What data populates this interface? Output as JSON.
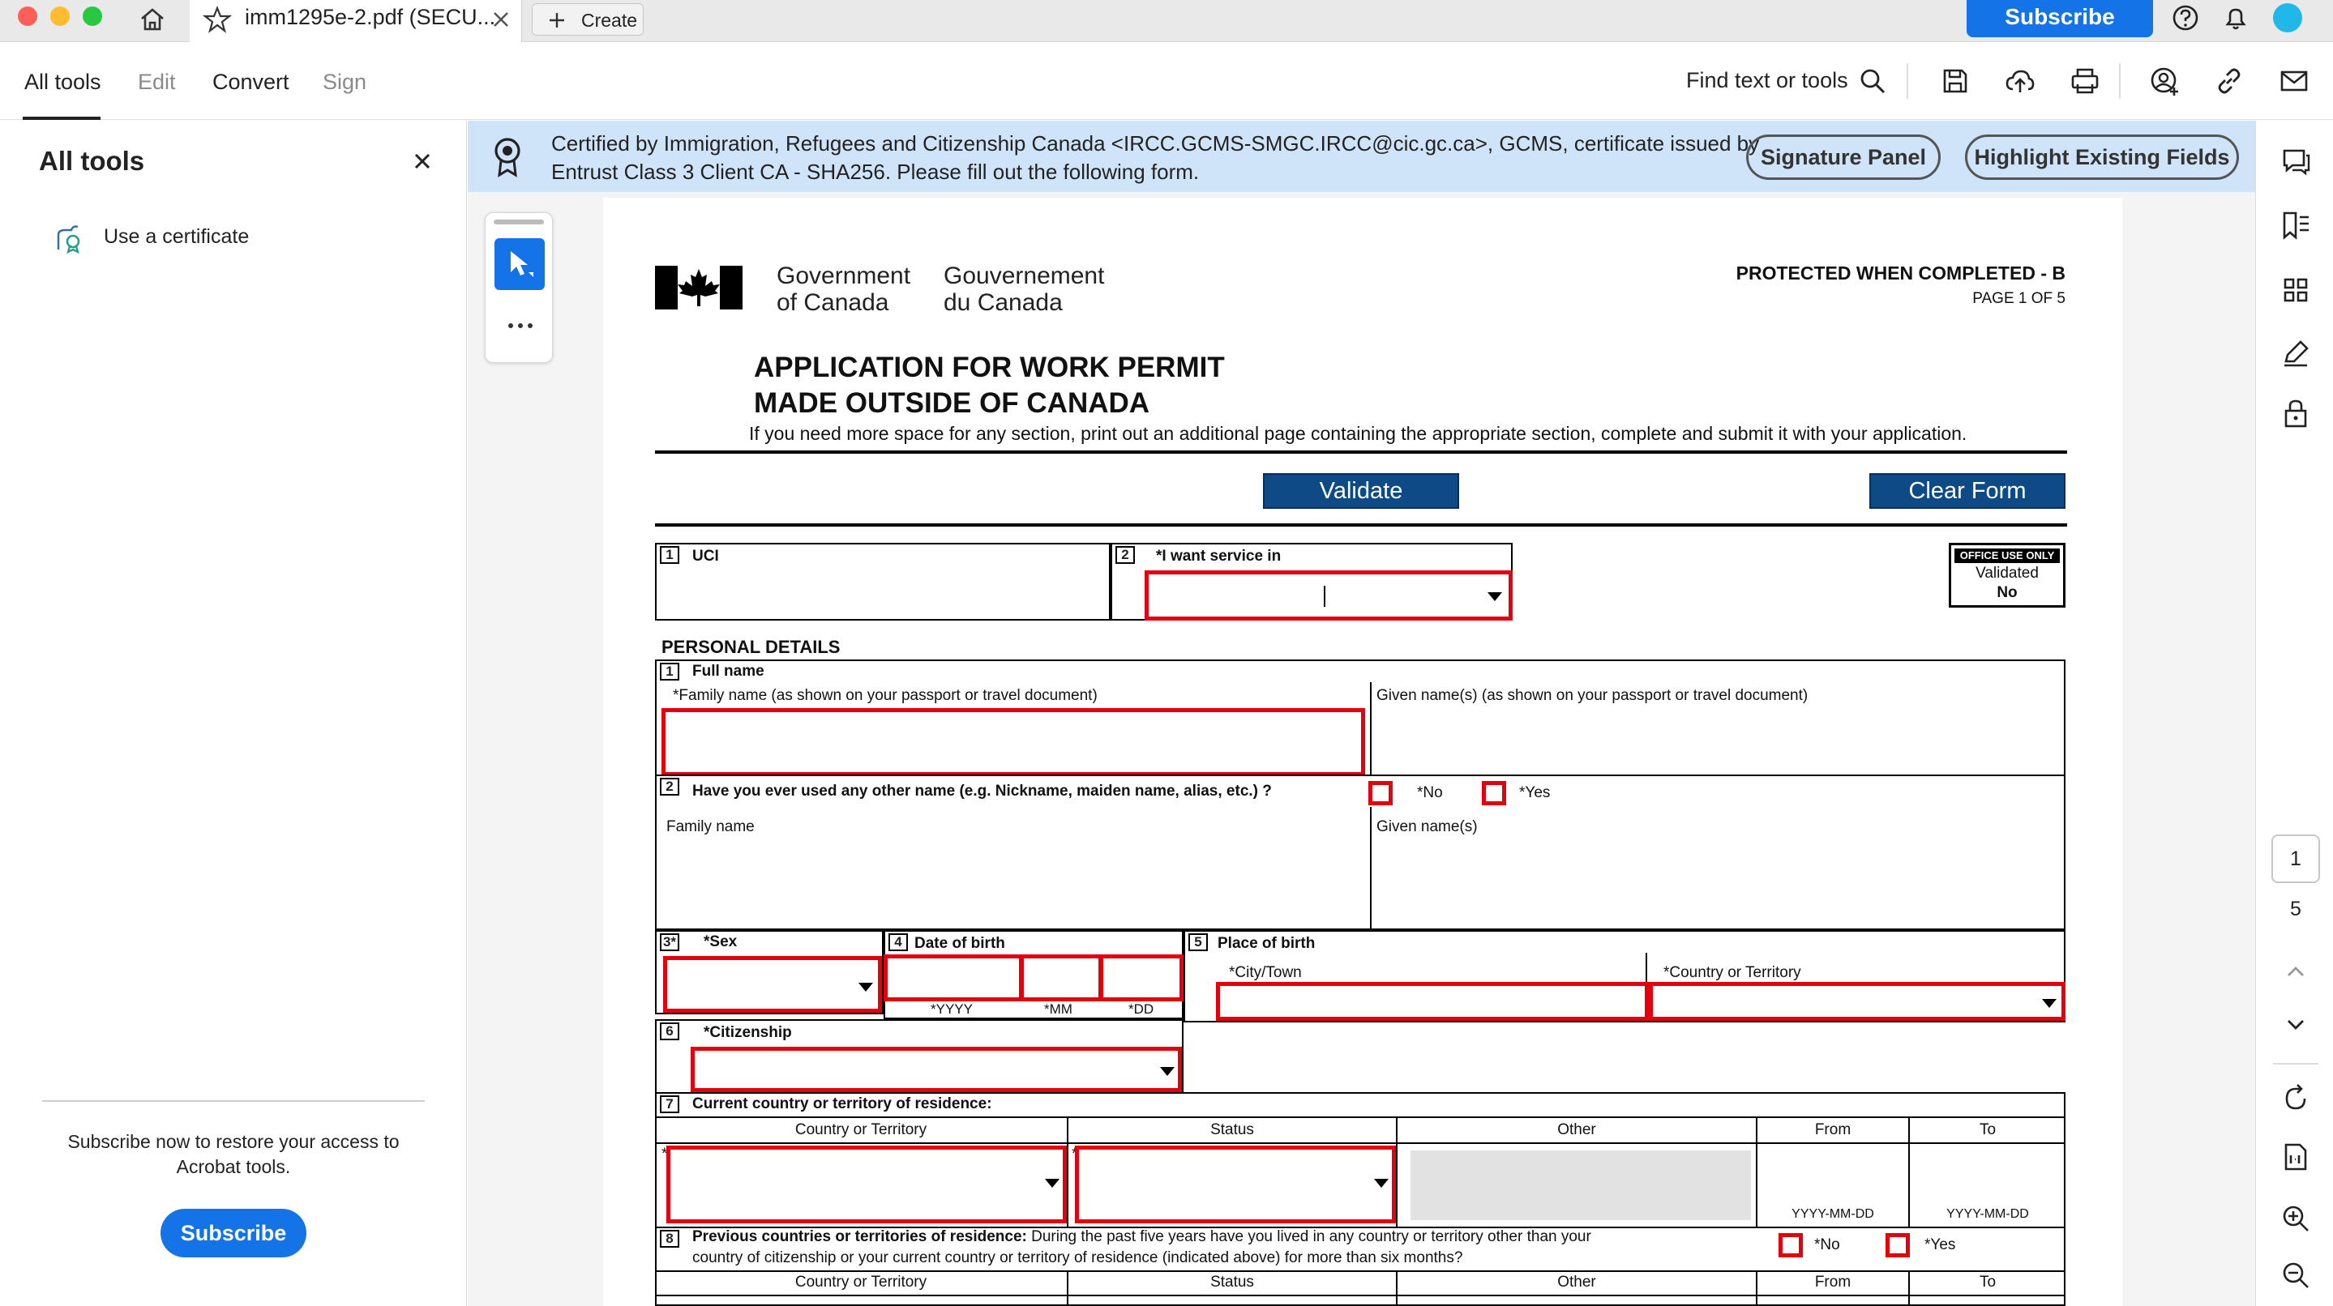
{
  "titlebar": {
    "tab_title": "imm1295e-2.pdf (SECU...",
    "create_label": "Create",
    "subscribe_label": "Subscribe"
  },
  "toolbar": {
    "menus": [
      "All tools",
      "Edit",
      "Convert",
      "Sign"
    ],
    "find_label": "Find text or tools"
  },
  "left_panel": {
    "title": "All tools",
    "tool_item": "Use a certificate",
    "restore_text": "Subscribe now to restore your access to Acrobat tools.",
    "subscribe_label": "Subscribe"
  },
  "banner": {
    "line1": "Certified by Immigration, Refugees and Citizenship Canada <IRCC.GCMS-SMGC.IRCC@cic.gc.ca>, GCMS, certificate issued by",
    "line2": "Entrust Class 3 Client CA - SHA256.  Please fill out the following form.",
    "signature_panel": "Signature Panel",
    "highlight_fields": "Highlight Existing Fields"
  },
  "right_rail": {
    "current_page": "1",
    "total_pages": "5"
  },
  "form": {
    "gov_en_1": "Government",
    "gov_en_2": "of Canada",
    "gov_fr_1": "Gouvernement",
    "gov_fr_2": "du Canada",
    "protected": "PROTECTED WHEN COMPLETED - B",
    "page_of": "PAGE 1 OF 5",
    "title_1": "APPLICATION FOR WORK PERMIT",
    "title_2": "MADE OUTSIDE OF CANADA",
    "instructions": "If you need more space for any section, print out an additional page containing the appropriate section, complete and submit it with your application.",
    "validate": "Validate",
    "clear_form": "Clear Form",
    "q1_num": "1",
    "q1_label": "UCI",
    "q2_num": "2",
    "q2_label": "*I want service in",
    "office_use": "OFFICE USE ONLY",
    "validated": "Validated",
    "validated_value": "No",
    "section_personal": "PERSONAL DETAILS",
    "p1_num": "1",
    "p1_label": "Full name",
    "family_name_label": "*Family name (as shown on your passport or travel document)",
    "given_name_label": "Given name(s) (as shown on your passport or travel document)",
    "p2_num": "2",
    "p2_label": "Have you ever used any other name (e.g. Nickname, maiden name, alias, etc.) ?",
    "no_label": "*No",
    "yes_label": "*Yes",
    "other_family": "Family name",
    "other_given": "Given name(s)",
    "p3_num": "3*",
    "p3_label": "*Sex",
    "p4_num": "4",
    "p4_label": "Date of birth",
    "yyyy": "*YYYY",
    "mm": "*MM",
    "dd": "*DD",
    "p5_num": "5",
    "p5_label": "Place of birth",
    "city_label": "*City/Town",
    "country_label": "*Country or Territory",
    "p6_num": "6",
    "p6_label": "*Citizenship",
    "p7_num": "7",
    "p7_label": "Current country or territory of residence:",
    "col_country": "Country or Territory",
    "col_status": "Status",
    "col_other": "Other",
    "col_from": "From",
    "col_to": "To",
    "date_fmt": "YYYY-MM-DD",
    "p8_num": "8",
    "p8_bold": "Previous countries or territories of residence:",
    "p8_text_1": "During the past five years have you lived in any country or territory other than your",
    "p8_text_2": "country of citizenship or your current country or territory of residence (indicated above) for more than six months?",
    "star": "*"
  }
}
